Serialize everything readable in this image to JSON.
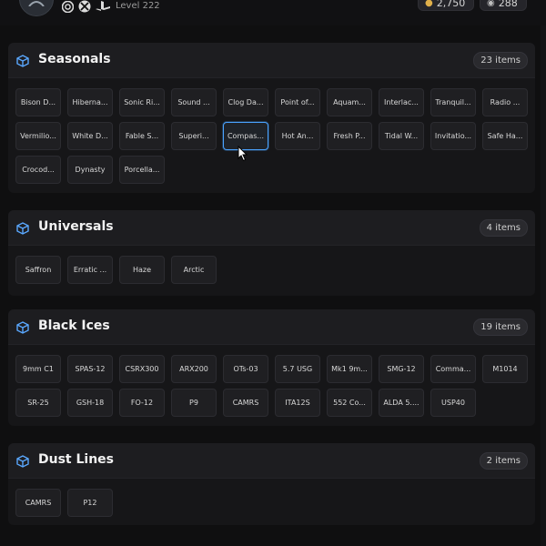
{
  "header": {
    "level": "Level 222",
    "currency": [
      {
        "icon": "coin-icon",
        "value": "2,750"
      },
      {
        "icon": "token-icon",
        "value": "288"
      }
    ],
    "platforms": [
      "ubisoft-icon",
      "xbox-icon",
      "playstation-icon"
    ]
  },
  "sections": [
    {
      "title": "Seasonals",
      "count": "23 items",
      "items": [
        "Bison D...",
        "Hiberna...",
        "Sonic Ri...",
        "Sound ...",
        "Clog Da...",
        "Point of...",
        "Aquam...",
        "Interlac...",
        "Tranquil...",
        "Radio ...",
        "Vermilio...",
        "White D...",
        "Fable S...",
        "Superi...",
        "Compas...",
        "Hot An...",
        "Fresh P...",
        "Tidal W...",
        "Invitatio...",
        "Safe Ha...",
        "Crocod...",
        "Dynasty",
        "Porcella..."
      ],
      "active_index": 14
    },
    {
      "title": "Universals",
      "count": "4 items",
      "items": [
        "Saffron",
        "Erratic ...",
        "Haze",
        "Arctic"
      ],
      "active_index": -1
    },
    {
      "title": "Black Ices",
      "count": "19 items",
      "items": [
        "9mm C1",
        "SPAS-12",
        "CSRX300",
        "ARX200",
        "OTs-03",
        "5.7 USG",
        "Mk1 9m...",
        "SMG-12",
        "Comma...",
        "M1014",
        "SR-25",
        "GSH-18",
        "FO-12",
        "P9",
        "CAMRS",
        "ITA12S",
        "552 Co...",
        "ALDA 5....",
        "USP40"
      ],
      "active_index": -1
    },
    {
      "title": "Dust Lines",
      "count": "2 items",
      "items": [
        "CAMRS",
        "P12"
      ],
      "active_index": -1
    }
  ],
  "colors": {
    "accent": "#4aa3ff",
    "section_icon": "#5aa8ff"
  }
}
